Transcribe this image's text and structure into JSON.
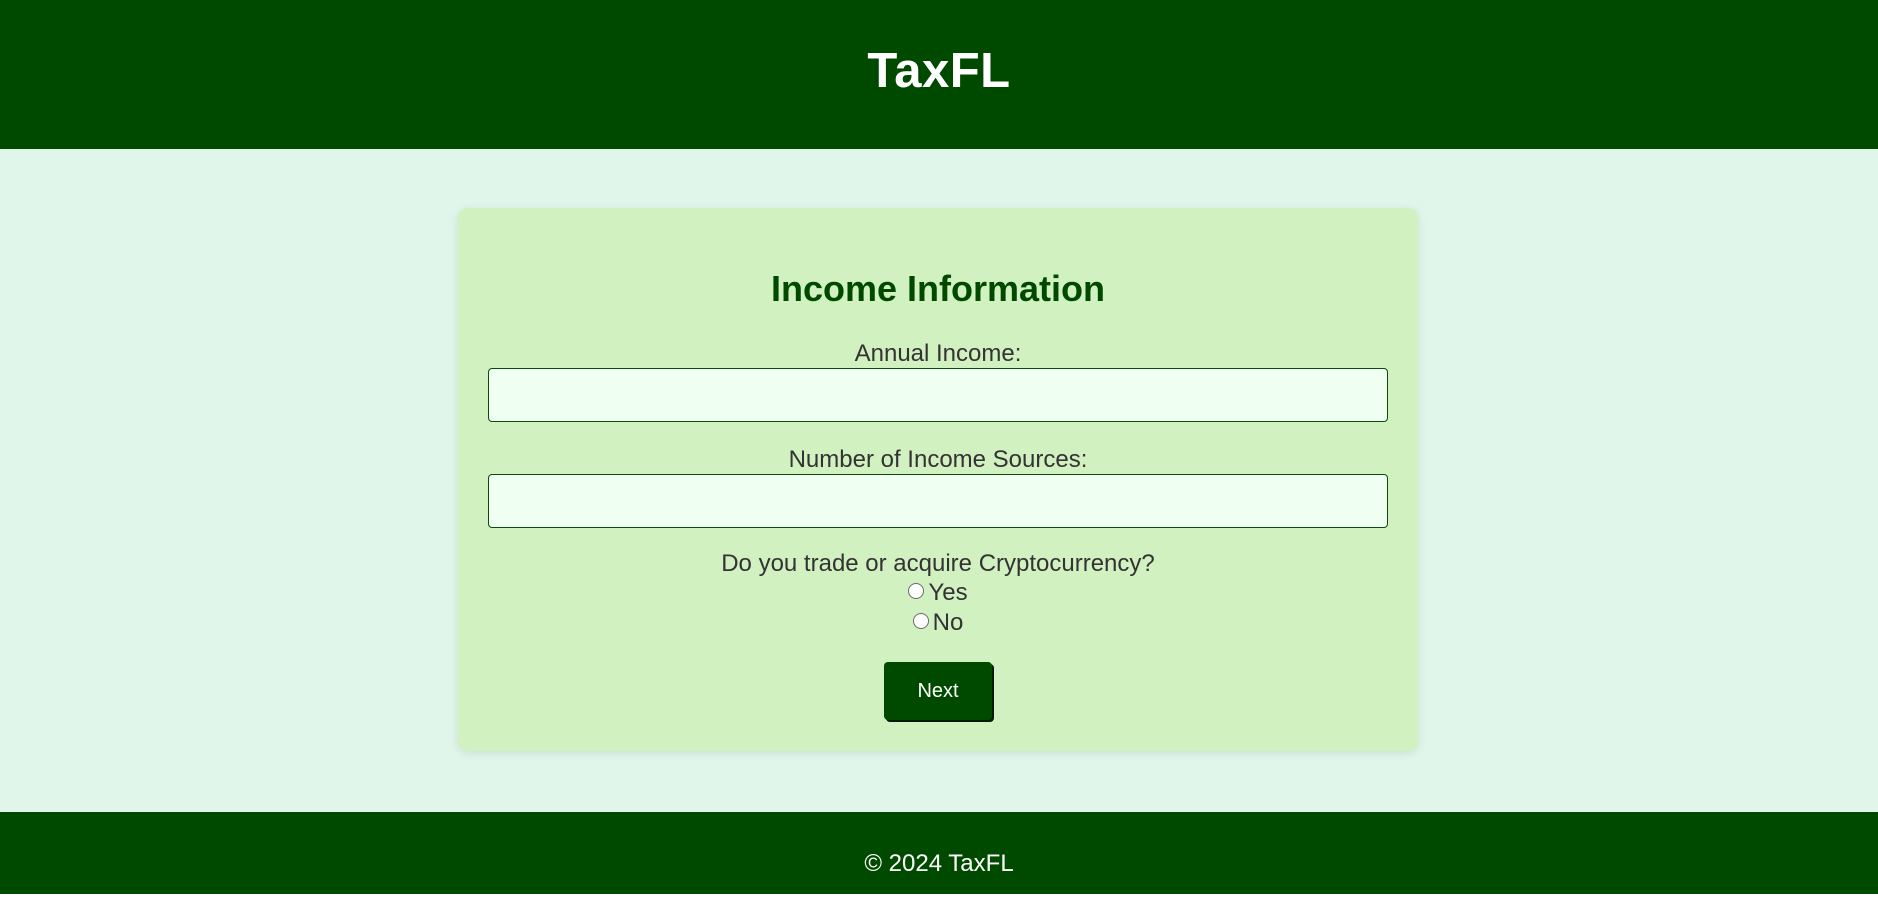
{
  "header": {
    "title": "TaxFL"
  },
  "form": {
    "title": "Income Information",
    "annual_income": {
      "label": "Annual Income:",
      "value": "",
      "placeholder": ""
    },
    "income_sources": {
      "label": "Number of Income Sources:",
      "value": "",
      "placeholder": ""
    },
    "crypto": {
      "question": "Do you trade or acquire Cryptocurrency?",
      "options": [
        {
          "label": "Yes",
          "selected": false
        },
        {
          "label": "No",
          "selected": false
        }
      ]
    },
    "next_label": "Next"
  },
  "footer": {
    "text": "© 2024 TaxFL"
  },
  "colors": {
    "header_bg": "#004a00",
    "page_bg": "#e1f6ea",
    "card_bg": "#d1f1c1",
    "input_bg": "#effff1",
    "title_color": "#004a00"
  }
}
